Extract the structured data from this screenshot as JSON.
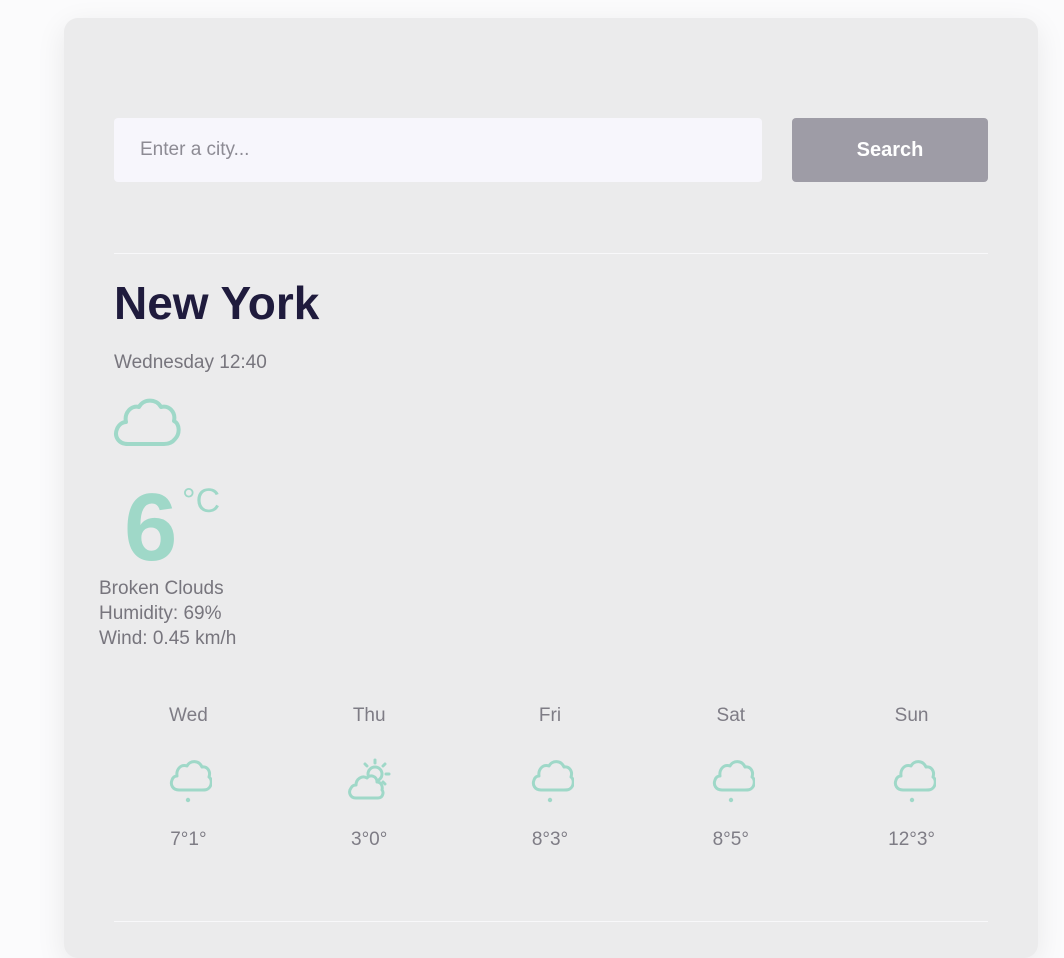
{
  "search": {
    "placeholder": "Enter a city...",
    "button_label": "Search"
  },
  "current": {
    "city": "New York",
    "datetime": "Wednesday 12:40",
    "icon": "cloud-icon",
    "temperature": "6",
    "unit": "°C",
    "description": "Broken Clouds",
    "humidity": "Humidity: 69%",
    "wind": "Wind: 0.45 km/h"
  },
  "forecast": [
    {
      "day": "Wed",
      "icon": "rain-icon",
      "temps": "7°1°"
    },
    {
      "day": "Thu",
      "icon": "partly-sunny-icon",
      "temps": "3°0°"
    },
    {
      "day": "Fri",
      "icon": "rain-icon",
      "temps": "8°3°"
    },
    {
      "day": "Sat",
      "icon": "rain-icon",
      "temps": "8°5°"
    },
    {
      "day": "Sun",
      "icon": "rain-icon",
      "temps": "12°3°"
    }
  ],
  "colors": {
    "accent": "#9fd8c8",
    "heading": "#1f1b3d",
    "button": "#9e9ca6",
    "card": "#ebebec"
  }
}
